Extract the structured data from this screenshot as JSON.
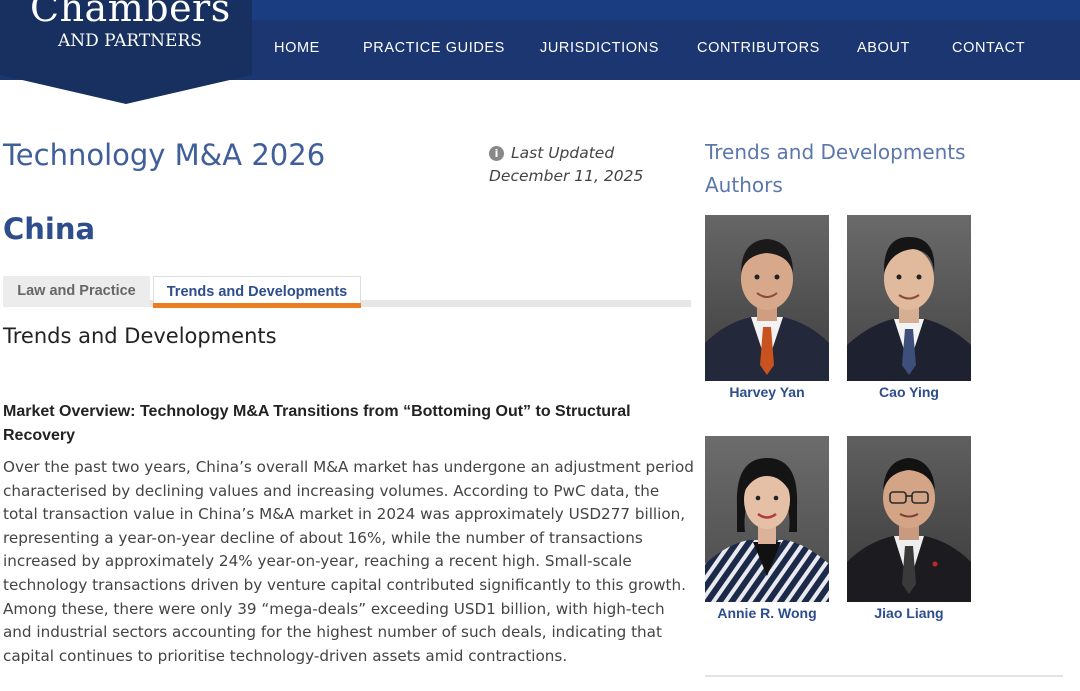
{
  "header": {
    "logo_main": "Chambers",
    "logo_sub": "AND PARTNERS",
    "nav": {
      "home": "HOME",
      "practice_guides": "PRACTICE GUIDES",
      "jurisdictions": "JURISDICTIONS",
      "contributors": "CONTRIBUTORS",
      "about": "ABOUT",
      "contact": "CONTACT"
    }
  },
  "main": {
    "title": "Technology M&A 2026",
    "last_updated_label": "Last Updated",
    "last_updated_date": "December 11, 2025",
    "country": "China",
    "tabs": {
      "law_and_practice": "Law and Practice",
      "trends_and_developments": "Trends and Developments"
    },
    "section_heading": "Trends and Developments",
    "article_heading": "Market Overview: Technology M&A Transitions from “Bottoming Out” to Structural Recovery",
    "article_body": "Over the past two years, China’s overall M&A market has undergone an adjustment period characterised by declining values and increasing volumes. According to PwC data, the total transaction value in China’s M&A market in 2024 was approximately USD277 billion, representing a year-on-year decline of about 16%, while the number of transactions increased by approximately 24% year-on-year, reaching a recent high. Small-scale technology transactions driven by venture capital contributed significantly to this growth. Among these, there were only 39 “mega-deals” exceeding USD1 billion, with high-tech and industrial sectors accounting for the highest number of such deals, indicating that capital continues to prioritise technology-driven assets amid contractions."
  },
  "sidebar": {
    "title_line1": "Trends and Developments",
    "title_line2": "Authors",
    "authors": [
      {
        "name": "Harvey Yan",
        "tie_color": "#c8531e",
        "skin": "#d8a88a",
        "hair": "#1a1a1a"
      },
      {
        "name": "Cao Ying",
        "tie_color": "#3d4f7a",
        "skin": "#e1b99c",
        "hair": "#151515"
      },
      {
        "name": "Annie R. Wong",
        "tie_color": "#ffffff",
        "skin": "#e6c0a6",
        "hair": "#141414"
      },
      {
        "name": "Jiao Liang",
        "tie_color": "#3a3a3a",
        "skin": "#d4a487",
        "hair": "#121212"
      }
    ]
  },
  "colors": {
    "nav_bg": "#1b3671",
    "accent_orange": "#ee7d22",
    "title_blue": "#3f5e9a",
    "link_blue": "#2e4d8c"
  }
}
